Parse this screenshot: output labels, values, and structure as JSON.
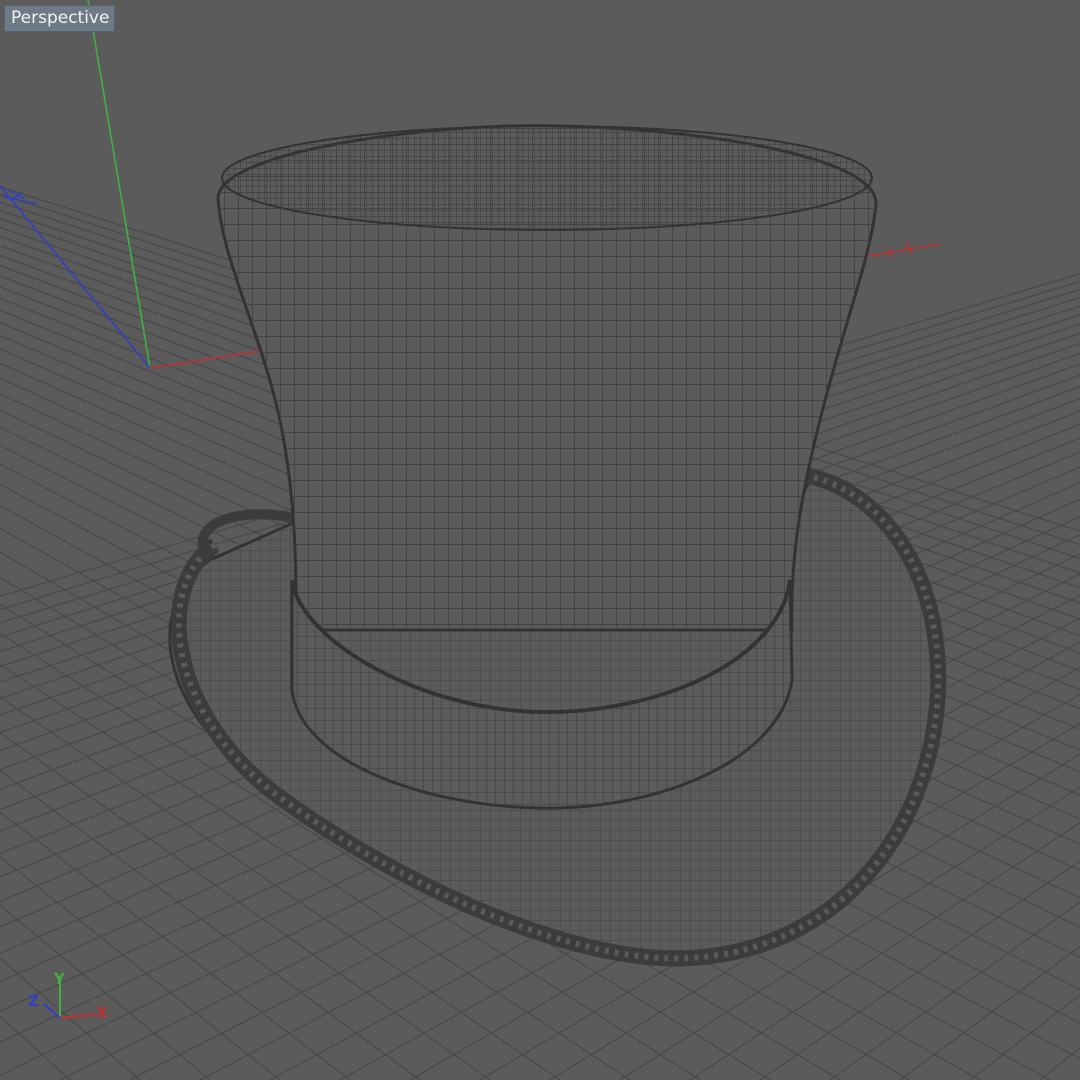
{
  "viewport": {
    "view_label": "Perspective",
    "colors": {
      "background": "#5b5b5b",
      "grid": "#4a4a4a",
      "wire": "#3a3a3a",
      "axis_x": "#c03030",
      "axis_y": "#40b040",
      "axis_z": "#3040c0"
    }
  },
  "gizmo": {
    "x_label": "X",
    "y_label": "Y",
    "z_label": "Z"
  }
}
